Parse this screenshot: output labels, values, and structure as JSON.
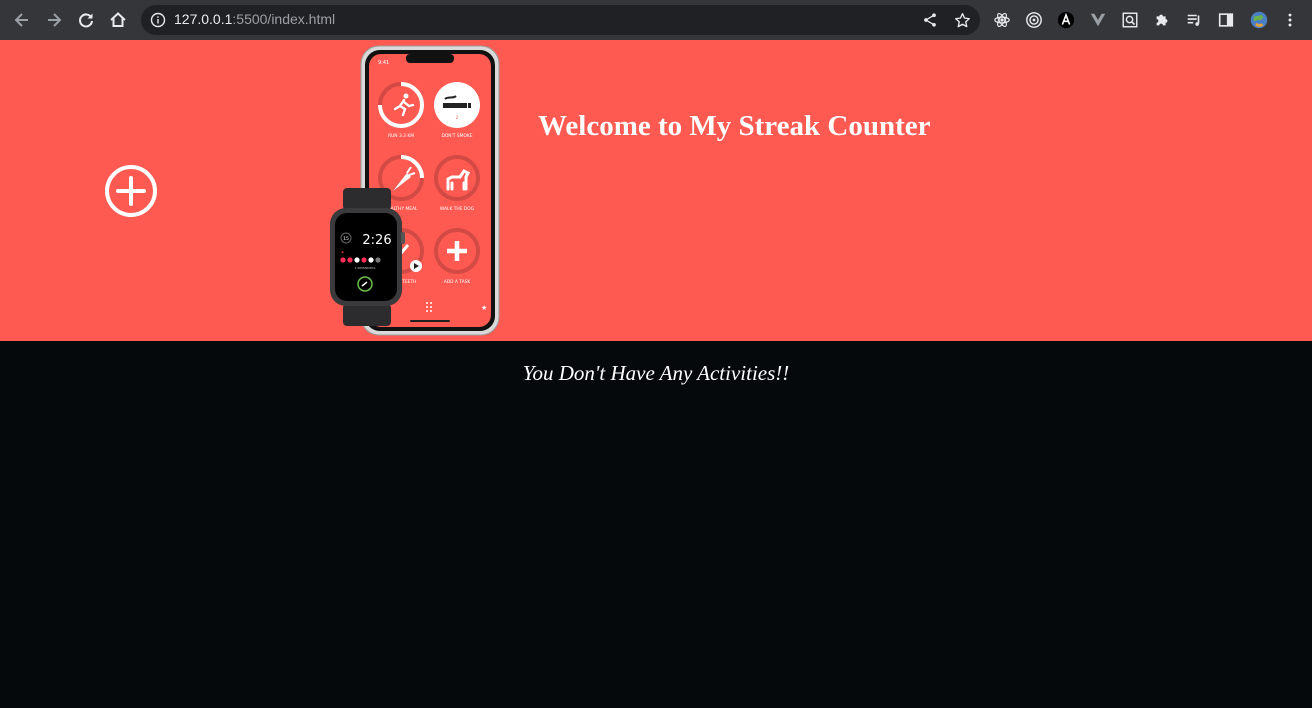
{
  "browser": {
    "url_host": "127.0.0.1",
    "url_rest": ":5500/index.html",
    "nav": [
      "back-icon",
      "forward-icon",
      "reload-icon",
      "home-icon"
    ],
    "omnibox_icons": [
      "share-icon",
      "bookmark-star-icon"
    ],
    "extensions": [
      "react-devtools-icon",
      "target-icon",
      "a-extension-icon",
      "vue-devtools-icon",
      "screenshot-icon",
      "extensions-puzzle-icon",
      "reading-list-icon",
      "side-panel-icon",
      "profile-avatar",
      "menu-kebab-icon"
    ]
  },
  "page": {
    "title": "Welcome to My Streak Counter",
    "empty_message": "You Don't Have Any Activities!!",
    "accent_color": "#ff5a52",
    "background_color": "#05090c"
  },
  "phone_app": {
    "status_time": "9:41",
    "tasks": [
      {
        "label": "RUN 3.3 KM",
        "icon": "running-icon"
      },
      {
        "label": "DON'T SMOKE",
        "icon": "no-smoking-icon"
      },
      {
        "label": "HEALTHY MEAL",
        "icon": "carrot-icon"
      },
      {
        "label": "WALK THE DOG",
        "icon": "dog-icon"
      },
      {
        "label": "BRUSH TEETH",
        "icon": "toothbrush-icon"
      },
      {
        "label": "ADD A TASK",
        "icon": "plus-icon"
      }
    ]
  },
  "watch_app": {
    "time": "2:26",
    "date": "15",
    "caption": "2 REMINDERS"
  }
}
